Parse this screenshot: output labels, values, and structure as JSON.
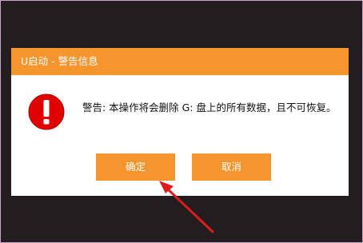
{
  "dialog": {
    "title": "U启动 - 警告信息",
    "message": "警告: 本操作将会删除 G: 盘上的所有数据，且不可恢复。",
    "icon": "warning-exclamation-icon",
    "ok_label": "确定",
    "cancel_label": "取消"
  },
  "colors": {
    "accent": "#f6952e",
    "warning": "#e00000",
    "annotation": "#e11b1b"
  }
}
